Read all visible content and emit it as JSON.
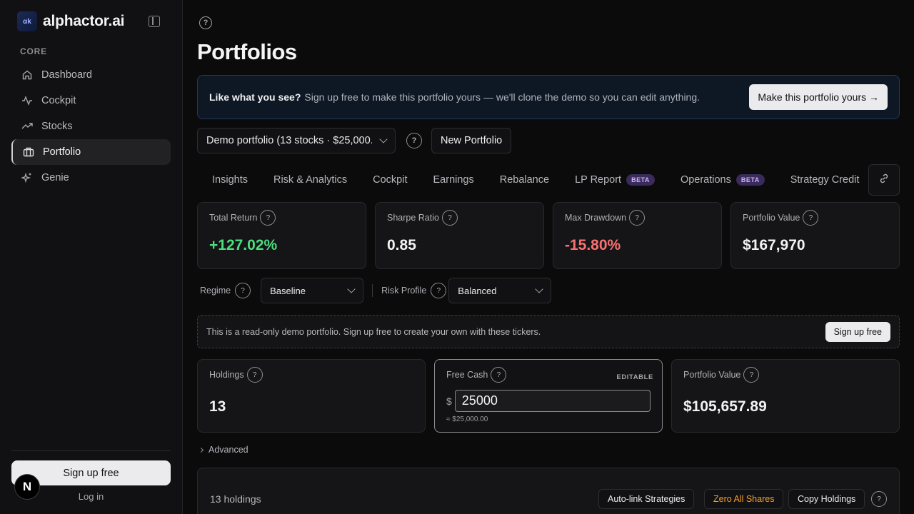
{
  "brand": {
    "name": "alphactor.ai",
    "logo_text": "αk"
  },
  "sidebar": {
    "section": "CORE",
    "items": [
      {
        "label": "Dashboard",
        "icon": "home-icon"
      },
      {
        "label": "Cockpit",
        "icon": "activity-icon"
      },
      {
        "label": "Stocks",
        "icon": "trending-up-icon"
      },
      {
        "label": "Portfolio",
        "icon": "briefcase-icon",
        "active": true
      },
      {
        "label": "Genie",
        "icon": "sparkles-icon"
      }
    ],
    "signup_label": "Sign up free",
    "login_label": "Log in",
    "badge": "N"
  },
  "page": {
    "title": "Portfolios",
    "help": "?"
  },
  "banner": {
    "strong": "Like what you see?",
    "text": "Sign up free to make this portfolio yours — we'll clone the demo so you can edit anything.",
    "button": "Make this portfolio yours →"
  },
  "portfolio_select": {
    "value": "Demo portfolio (13 stocks · $25,000.",
    "new_label": "New Portfolio"
  },
  "tabs": [
    {
      "label": "Insights"
    },
    {
      "label": "Risk & Analytics"
    },
    {
      "label": "Cockpit"
    },
    {
      "label": "Earnings"
    },
    {
      "label": "Rebalance"
    },
    {
      "label": "LP Report",
      "badge": "BETA"
    },
    {
      "label": "Operations",
      "badge": "BETA"
    },
    {
      "label": "Strategy Credit"
    }
  ],
  "metrics": [
    {
      "label": "Total Return",
      "value": "+127.02%",
      "tone": "pos"
    },
    {
      "label": "Sharpe Ratio",
      "value": "0.85",
      "tone": ""
    },
    {
      "label": "Max Drawdown",
      "value": "-15.80%",
      "tone": "neg"
    },
    {
      "label": "Portfolio Value",
      "value": "$167,970",
      "tone": ""
    }
  ],
  "controls": {
    "regime_label": "Regime",
    "regime_value": "Baseline",
    "risk_label": "Risk Profile",
    "risk_value": "Balanced"
  },
  "notice": {
    "text": "This is a read-only demo portfolio. Sign up free to create your own with these tickers.",
    "button": "Sign up free"
  },
  "stats": {
    "holdings_label": "Holdings",
    "holdings_value": "13",
    "cash_label": "Free Cash",
    "cash_tag": "EDITABLE",
    "cash_currency": "$",
    "cash_value": "25000",
    "cash_sub": "≈ $25,000.00",
    "value_label": "Portfolio Value",
    "value_value": "$105,657.89"
  },
  "advanced_label": "Advanced",
  "holdings_panel": {
    "count": "13 holdings",
    "autolink": "Auto-link Strategies",
    "zero": "Zero All Shares",
    "copy": "Copy Holdings"
  },
  "colors": {
    "positive": "#4ade80",
    "negative": "#f87171",
    "warning": "#f59e2e",
    "beta_bg": "#3a2b5c"
  }
}
